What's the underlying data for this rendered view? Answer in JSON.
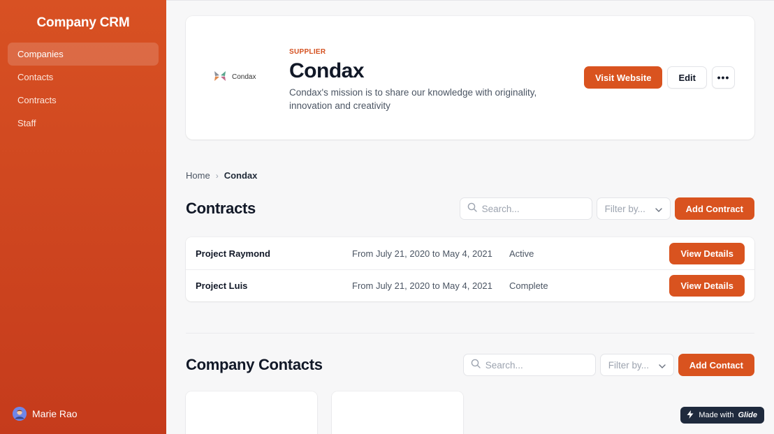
{
  "app": {
    "title": "Company CRM"
  },
  "sidebar": {
    "items": [
      {
        "label": "Companies",
        "active": true
      },
      {
        "label": "Contacts",
        "active": false
      },
      {
        "label": "Contracts",
        "active": false
      },
      {
        "label": "Staff",
        "active": false
      }
    ],
    "user": {
      "name": "Marie Rao"
    }
  },
  "company": {
    "logo_text": "Condax",
    "tag": "SUPPLIER",
    "name": "Condax",
    "mission": "Condax's mission is to share our knowledge with originality, innovation and creativity",
    "actions": {
      "visit": "Visit Website",
      "edit": "Edit",
      "more": "•••"
    }
  },
  "breadcrumb": {
    "home": "Home",
    "separator": "›",
    "current": "Condax"
  },
  "contracts": {
    "title": "Contracts",
    "search_placeholder": "Search...",
    "filter_label": "Filter by...",
    "add_label": "Add Contract",
    "rows": [
      {
        "name": "Project Raymond",
        "dates": "From July 21, 2020 to May 4, 2021",
        "status": "Active",
        "action": "View Details"
      },
      {
        "name": "Project Luis",
        "dates": "From July 21, 2020 to May 4, 2021",
        "status": "Complete",
        "action": "View Details"
      }
    ]
  },
  "contacts": {
    "title": "Company Contacts",
    "search_placeholder": "Search...",
    "filter_label": "Filter by...",
    "add_label": "Add Contact"
  },
  "badge": {
    "prefix": "Made with",
    "brand": "Glide"
  },
  "colors": {
    "accent": "#d9531f",
    "sidebar_top": "#d85123",
    "sidebar_bottom": "#c53b1c",
    "badge_bg": "#1f2a3d"
  },
  "icons": [
    "condax-logo-icon",
    "search-icon",
    "chevron-down-icon",
    "lightning-icon",
    "avatar"
  ]
}
